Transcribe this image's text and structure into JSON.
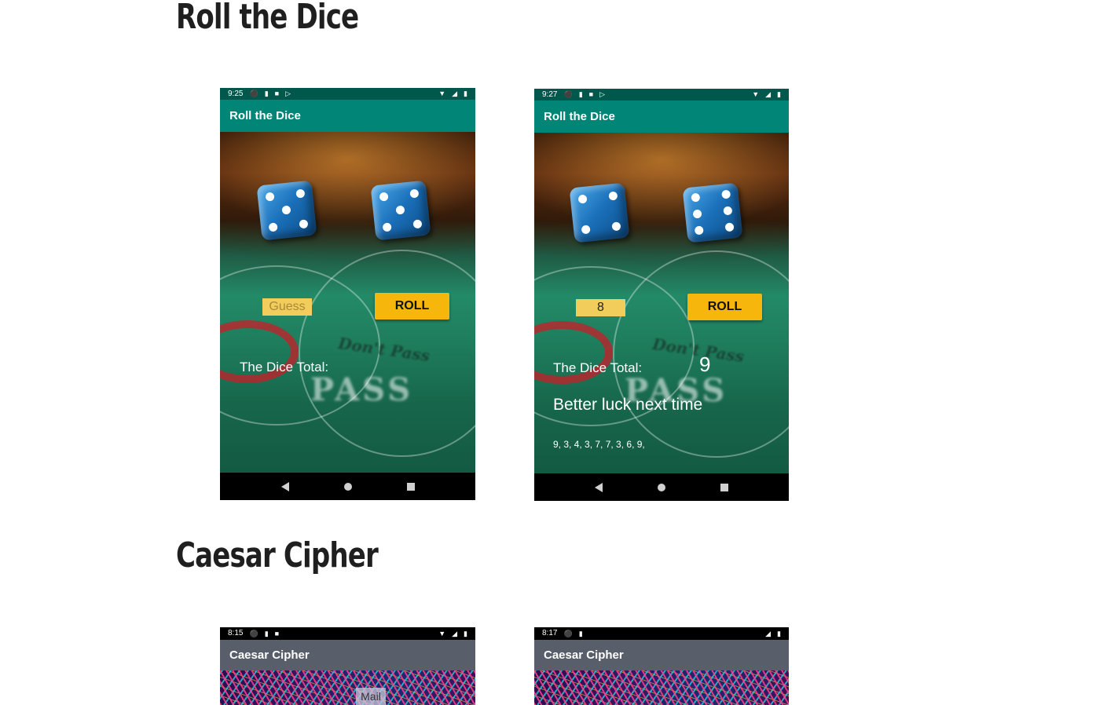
{
  "sections": {
    "dice_title": "Roll the Dice",
    "cipher_title": "Caesar Cipher"
  },
  "dice_phone_1": {
    "time": "9:25",
    "app_title": "Roll the Dice",
    "guess_placeholder": "Guess",
    "roll_label": "ROLL",
    "total_label": "The Dice Total:"
  },
  "dice_phone_2": {
    "time": "9:27",
    "app_title": "Roll the Dice",
    "guess_value": "8",
    "roll_label": "ROLL",
    "total_label": "The Dice Total:",
    "total_value": "9",
    "result_message": "Better luck next time",
    "history": "9, 3, 4, 3, 7, 7, 3, 6, 9,"
  },
  "felt": {
    "pass": "PASS",
    "dont_pass": "Don't Pass"
  },
  "cipher_phone_1": {
    "time": "8:15",
    "app_title": "Caesar Cipher",
    "mail_label": "Mail"
  },
  "cipher_phone_2": {
    "time": "8:17",
    "app_title": "Caesar Cipher"
  },
  "colors": {
    "dice_statusbar": "#00574b",
    "dice_appbar": "#008577",
    "roll_button": "#f6b60c",
    "guess_field": "#f2cd5c",
    "cipher_appbar": "#595f6a"
  },
  "icons": [
    "shield-icon",
    "key-icon",
    "sim-icon",
    "play-icon",
    "wifi-icon",
    "signal-icon",
    "battery-icon",
    "back-icon",
    "home-icon",
    "recents-icon"
  ]
}
